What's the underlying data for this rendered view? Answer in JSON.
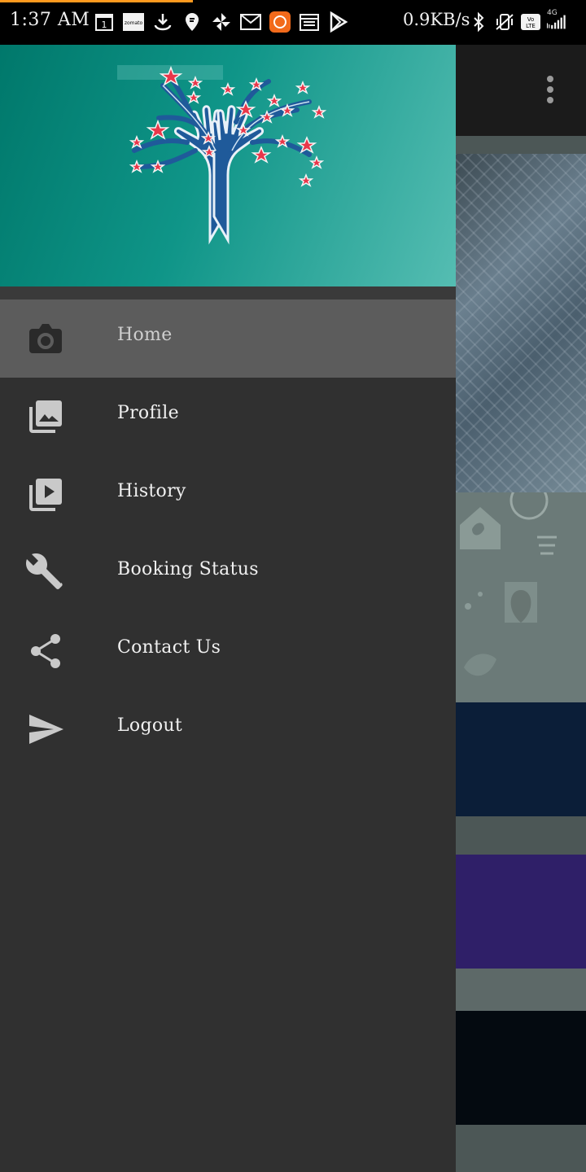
{
  "status_bar": {
    "time": "1:37 AM",
    "calendar_day": "1",
    "zomato_label": "zomato",
    "network_speed": "0.9KB/s",
    "volte_label": "Vo LTE",
    "network_type": "4G",
    "accent_color": "#ff9a1f"
  },
  "drawer": {
    "header_colors": [
      "#00786b",
      "#55bdb2"
    ],
    "background_color": "#303030",
    "active_item_color": "#5c5c5c",
    "menu_items": [
      {
        "label": "Home",
        "icon": "camera-icon",
        "active": true
      },
      {
        "label": "Profile",
        "icon": "photo-library-icon",
        "active": false
      },
      {
        "label": "History",
        "icon": "video-library-icon",
        "active": false
      },
      {
        "label": "Booking Status",
        "icon": "wrench-icon",
        "active": false
      },
      {
        "label": "Contact Us",
        "icon": "share-icon",
        "active": false
      },
      {
        "label": "Logout",
        "icon": "send-icon",
        "active": false
      }
    ]
  },
  "app_bar": {
    "overflow_icon": "more-vert-icon"
  }
}
